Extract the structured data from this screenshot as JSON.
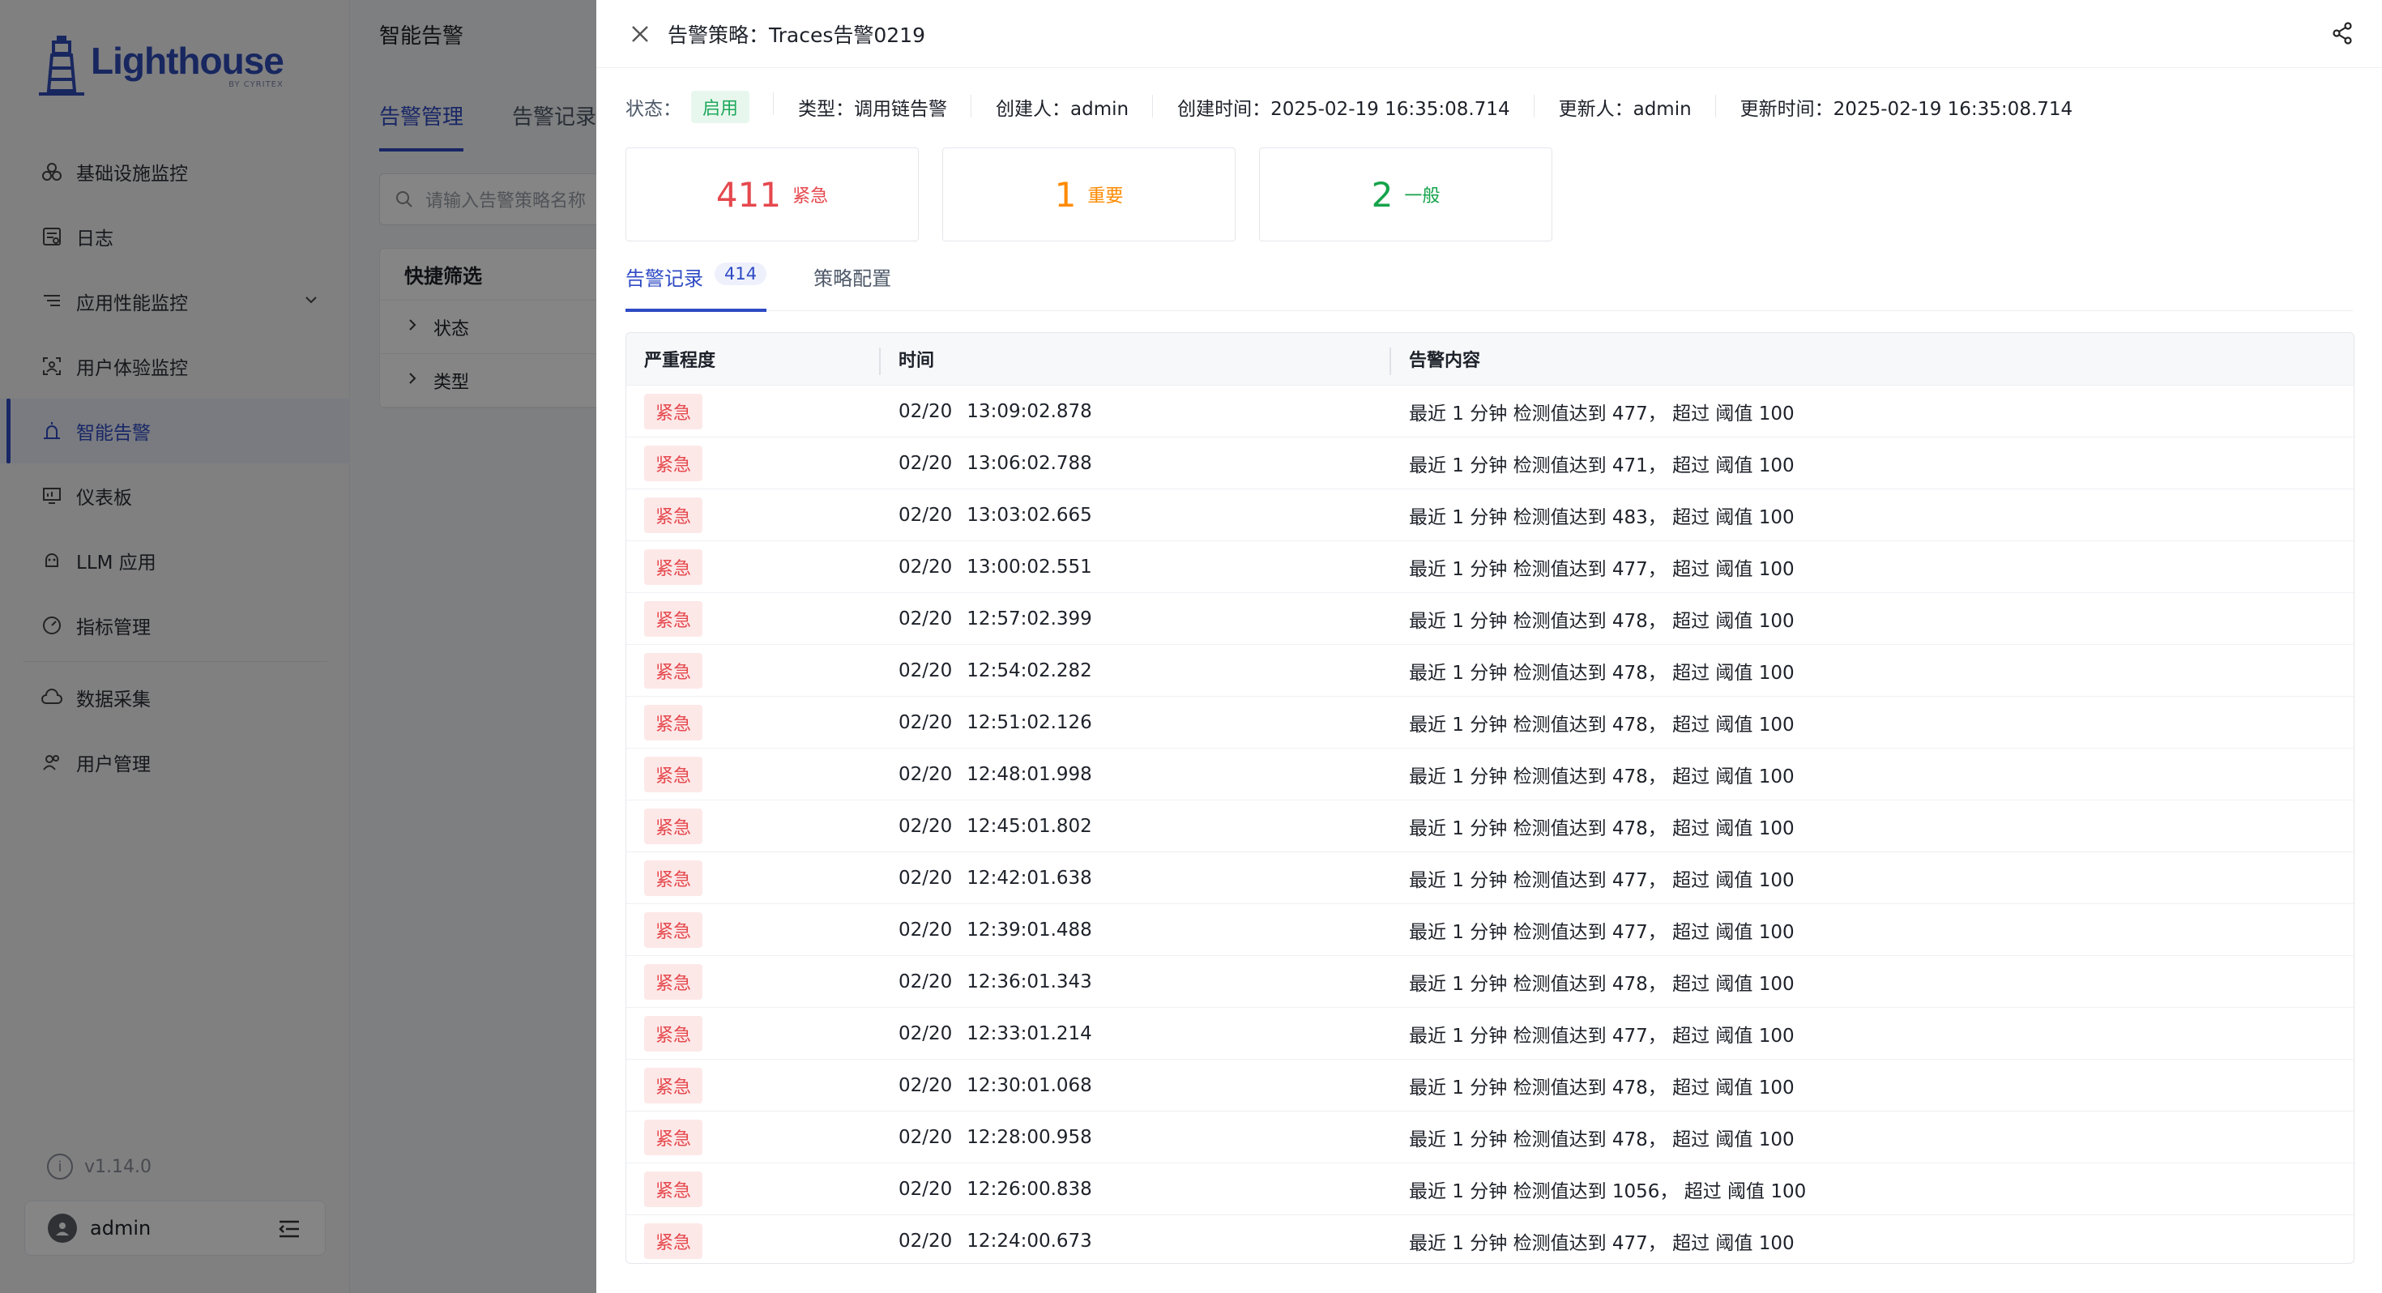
{
  "sidebar": {
    "logo_word": "Lighthouse",
    "logo_sub": "BY CYRITEX",
    "items": [
      {
        "label": "基础设施监控",
        "icon": "infrastructure-icon"
      },
      {
        "label": "日志",
        "icon": "log-icon"
      },
      {
        "label": "应用性能监控",
        "icon": "apm-icon"
      },
      {
        "label": "用户体验监控",
        "icon": "user-experience-icon"
      },
      {
        "label": "智能告警",
        "icon": "alert-icon"
      },
      {
        "label": "仪表板",
        "icon": "dashboard-icon"
      },
      {
        "label": "LLM 应用",
        "icon": "llm-icon"
      },
      {
        "label": "指标管理",
        "icon": "metrics-icon"
      },
      {
        "label": "数据采集",
        "icon": "data-collection-icon"
      },
      {
        "label": "用户管理",
        "icon": "user-management-icon"
      }
    ],
    "version": "v1.14.0",
    "user": "admin"
  },
  "background": {
    "page_title": "智能告警",
    "tabs": [
      "告警管理",
      "告警记录"
    ],
    "search_placeholder": "请输入告警策略名称",
    "filter_title": "快捷筛选",
    "filters": [
      "状态",
      "类型"
    ]
  },
  "drawer": {
    "title": "告警策略：Traces告警0219",
    "meta": {
      "status_label": "状态：",
      "status_value": "启用",
      "type": "类型：调用链告警",
      "creator": "创建人：admin",
      "created_at": "创建时间：2025-02-19 16:35:08.714",
      "updater": "更新人：admin",
      "updated_at": "更新时间：2025-02-19 16:35:08.714"
    },
    "stats": [
      {
        "count": "411",
        "label": "紧急",
        "color": "#e5484d"
      },
      {
        "count": "1",
        "label": "重要",
        "color": "#ff8a00"
      },
      {
        "count": "2",
        "label": "一般",
        "color": "#14a34a"
      }
    ],
    "tabs": {
      "records_label": "告警记录",
      "records_count": "414",
      "config_label": "策略配置"
    },
    "table": {
      "headers": [
        "严重程度",
        "时间",
        "告警内容"
      ],
      "rows": [
        {
          "severity": "紧急",
          "date": "02/20",
          "time": "13:09:02.878",
          "content": "最近 1 分钟 检测值达到 477， 超过 阈值 100"
        },
        {
          "severity": "紧急",
          "date": "02/20",
          "time": "13:06:02.788",
          "content": "最近 1 分钟 检测值达到 471， 超过 阈值 100"
        },
        {
          "severity": "紧急",
          "date": "02/20",
          "time": "13:03:02.665",
          "content": "最近 1 分钟 检测值达到 483， 超过 阈值 100"
        },
        {
          "severity": "紧急",
          "date": "02/20",
          "time": "13:00:02.551",
          "content": "最近 1 分钟 检测值达到 477， 超过 阈值 100"
        },
        {
          "severity": "紧急",
          "date": "02/20",
          "time": "12:57:02.399",
          "content": "最近 1 分钟 检测值达到 478， 超过 阈值 100"
        },
        {
          "severity": "紧急",
          "date": "02/20",
          "time": "12:54:02.282",
          "content": "最近 1 分钟 检测值达到 478， 超过 阈值 100"
        },
        {
          "severity": "紧急",
          "date": "02/20",
          "time": "12:51:02.126",
          "content": "最近 1 分钟 检测值达到 478， 超过 阈值 100"
        },
        {
          "severity": "紧急",
          "date": "02/20",
          "time": "12:48:01.998",
          "content": "最近 1 分钟 检测值达到 478， 超过 阈值 100"
        },
        {
          "severity": "紧急",
          "date": "02/20",
          "time": "12:45:01.802",
          "content": "最近 1 分钟 检测值达到 478， 超过 阈值 100"
        },
        {
          "severity": "紧急",
          "date": "02/20",
          "time": "12:42:01.638",
          "content": "最近 1 分钟 检测值达到 477， 超过 阈值 100"
        },
        {
          "severity": "紧急",
          "date": "02/20",
          "time": "12:39:01.488",
          "content": "最近 1 分钟 检测值达到 477， 超过 阈值 100"
        },
        {
          "severity": "紧急",
          "date": "02/20",
          "time": "12:36:01.343",
          "content": "最近 1 分钟 检测值达到 478， 超过 阈值 100"
        },
        {
          "severity": "紧急",
          "date": "02/20",
          "time": "12:33:01.214",
          "content": "最近 1 分钟 检测值达到 477， 超过 阈值 100"
        },
        {
          "severity": "紧急",
          "date": "02/20",
          "time": "12:30:01.068",
          "content": "最近 1 分钟 检测值达到 478， 超过 阈值 100"
        },
        {
          "severity": "紧急",
          "date": "02/20",
          "time": "12:28:00.958",
          "content": "最近 1 分钟 检测值达到 478， 超过 阈值 100"
        },
        {
          "severity": "紧急",
          "date": "02/20",
          "time": "12:26:00.838",
          "content": "最近 1 分钟 检测值达到 1056， 超过 阈值 100"
        },
        {
          "severity": "紧急",
          "date": "02/20",
          "time": "12:24:00.673",
          "content": "最近 1 分钟 检测值达到 477， 超过 阈值 100"
        }
      ]
    }
  },
  "colors": {
    "accent": "#2e4ac4",
    "urgent": "#e5484d",
    "important": "#ff8a00",
    "normal": "#14a34a",
    "enabled": "#1ea85a"
  }
}
